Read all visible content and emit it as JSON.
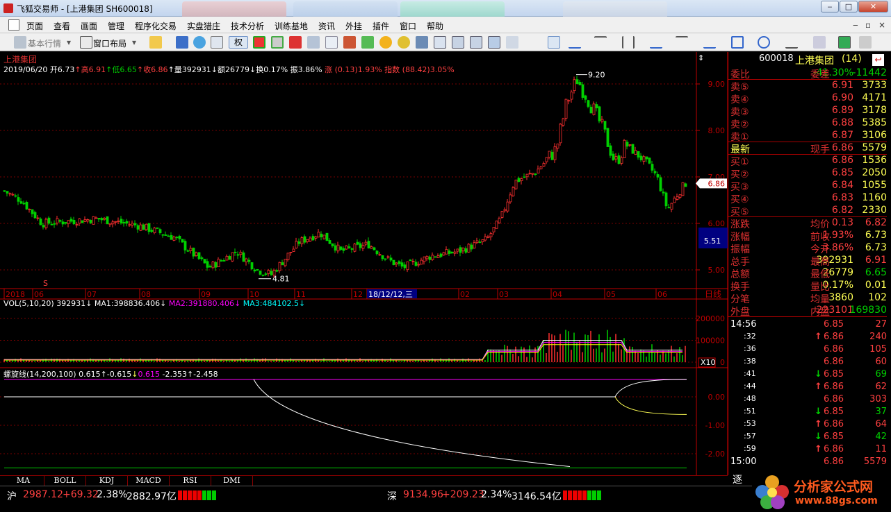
{
  "window": {
    "title": "飞狐交易师 - [上港集团 SH600018]",
    "controls": [
      "‒",
      "□",
      "✕"
    ]
  },
  "menu": [
    "页面",
    "查看",
    "画面",
    "管理",
    "程序化交易",
    "实盘猎庄",
    "技术分析",
    "训练基地",
    "资讯",
    "外挂",
    "插件",
    "窗口",
    "帮助"
  ],
  "toolbar": {
    "basic": "基本行情",
    "layout": "窗口布局",
    "quan": "权"
  },
  "chart": {
    "stock_name": "上港集团",
    "info": {
      "date": "2019/06/20",
      "open_l": "开",
      "open": "6.73",
      "high_l": "高",
      "high": "6.91",
      "low_l": "低",
      "low": "6.65",
      "close_l": "收",
      "close": "6.86",
      "vol_l": "量",
      "vol": "392931",
      "amt_l": "额",
      "amt": "26779",
      "turn_l": "换",
      "turn": "0.17%",
      "amp_l": "振",
      "amp": "3.86%",
      "chg": "涨 (0.13)1.93%",
      "index": "指数 (88.42)3.05%"
    },
    "price_axis": [
      "9.00",
      "8.00",
      "7.00",
      "6.00",
      "5.00"
    ],
    "high_marker": "9.20",
    "low_marker": "4.81",
    "last_price_tag": "6.86",
    "cursor_price_tag": "5.51",
    "date_axis": [
      "2018",
      "06",
      "07",
      "08",
      "09",
      "10",
      "11",
      "12",
      "18/12/12,三",
      "02",
      "03",
      "04",
      "05",
      "06"
    ],
    "period_label": "日线",
    "s_marker": "S",
    "vol_header": {
      "name": "VOL(5,10,20)",
      "v": "392931",
      "ma1": "MA1:398836.406",
      "ma2": "MA2:391880.406",
      "ma3": "MA3:484102.5"
    },
    "vol_axis": [
      "200000",
      "100000",
      "0"
    ],
    "vol_unit": "X10",
    "spiral_header": {
      "name": "螺旋线(14,200,100)",
      "a": "0.615",
      "b": "-0.615",
      "c": "0.615",
      "d": "-2.353",
      "e": "-2.458"
    },
    "spiral_axis": [
      "0.00",
      "-1.00",
      "-2.00"
    ],
    "bottom_tabs": [
      "MA",
      "BOLL",
      "KDJ",
      "MACD",
      "RSI",
      "DMI"
    ]
  },
  "quote": {
    "header": {
      "code": "600018",
      "name": "上港集团",
      "count": "(14)"
    },
    "weibi": {
      "label": "委比",
      "value": "-41.30%",
      "label2": "委差",
      "value2": "-11442"
    },
    "sell": [
      {
        "label": "卖⑤",
        "price": "6.91",
        "vol": "3733"
      },
      {
        "label": "卖④",
        "price": "6.90",
        "vol": "4171"
      },
      {
        "label": "卖③",
        "price": "6.89",
        "vol": "3178"
      },
      {
        "label": "卖②",
        "price": "6.88",
        "vol": "5385"
      },
      {
        "label": "卖①",
        "price": "6.87",
        "vol": "3106"
      }
    ],
    "latest": {
      "label": "最新",
      "price": "6.86",
      "label2": "现手",
      "vol": "5579"
    },
    "buy": [
      {
        "label": "买①",
        "price": "6.86",
        "vol": "1536"
      },
      {
        "label": "买②",
        "price": "6.85",
        "vol": "2050"
      },
      {
        "label": "买③",
        "price": "6.84",
        "vol": "1055"
      },
      {
        "label": "买④",
        "price": "6.83",
        "vol": "1160"
      },
      {
        "label": "买⑤",
        "price": "6.82",
        "vol": "2330"
      }
    ],
    "stats": [
      {
        "l1": "涨跌",
        "v1": "0.13",
        "l2": "均价",
        "v2": "6.82"
      },
      {
        "l1": "涨幅",
        "v1": "1.93%",
        "l2": "前收",
        "v2": "6.73"
      },
      {
        "l1": "振幅",
        "v1": "3.86%",
        "l2": "今开",
        "v2": "6.73"
      },
      {
        "l1": "总手",
        "v1": "392931",
        "l2": "最高",
        "v2": "6.91"
      },
      {
        "l1": "总额",
        "v1": "26779",
        "l2": "最低",
        "v2": "6.65"
      },
      {
        "l1": "换手",
        "v1": "0.17%",
        "l2": "量比",
        "v2": "0.01"
      },
      {
        "l1": "分笔",
        "v1": "3860",
        "l2": "均量",
        "v2": "102"
      }
    ],
    "outer": {
      "l1": "外盘",
      "v1": "223101",
      "l2": "内盘",
      "v2": "169830"
    },
    "ticks": [
      {
        "time": "14:56",
        "price": "6.85",
        "dir": "",
        "vol": "27"
      },
      {
        "time": ":32",
        "price": "6.86",
        "dir": "up",
        "vol": "240"
      },
      {
        "time": ":36",
        "price": "6.86",
        "dir": "",
        "vol": "105"
      },
      {
        "time": ":38",
        "price": "6.86",
        "dir": "",
        "vol": "60"
      },
      {
        "time": ":41",
        "price": "6.85",
        "dir": "down",
        "vol": "69"
      },
      {
        "time": ":44",
        "price": "6.86",
        "dir": "up",
        "vol": "62"
      },
      {
        "time": ":48",
        "price": "6.86",
        "dir": "",
        "vol": "303"
      },
      {
        "time": ":51",
        "price": "6.85",
        "dir": "down",
        "vol": "37"
      },
      {
        "time": ":53",
        "price": "6.86",
        "dir": "up",
        "vol": "64"
      },
      {
        "time": ":57",
        "price": "6.85",
        "dir": "down",
        "vol": "42"
      },
      {
        "time": ":59",
        "price": "6.86",
        "dir": "up",
        "vol": "11"
      },
      {
        "time": "15:00",
        "price": "6.86",
        "dir": "",
        "vol": "5579"
      }
    ],
    "zhu": "逐"
  },
  "status": {
    "sh": {
      "label": "沪",
      "price": "2987.12",
      "chg": "+69.32",
      "pct": "2.38%",
      "amt": "2882.97亿"
    },
    "sz": {
      "label": "深",
      "price": "9134.96",
      "chg": "+209.23",
      "pct": "2.34%",
      "amt": "3146.54亿"
    }
  },
  "watermark": {
    "text": "分析家公式网",
    "url": "www.88gs.com"
  },
  "colors": {
    "up": "#ff4040",
    "down": "#00d000",
    "axis": "#c00000",
    "text_yellow": "#ffff54",
    "cyan": "#00ffff",
    "magenta": "#ff00ff"
  }
}
